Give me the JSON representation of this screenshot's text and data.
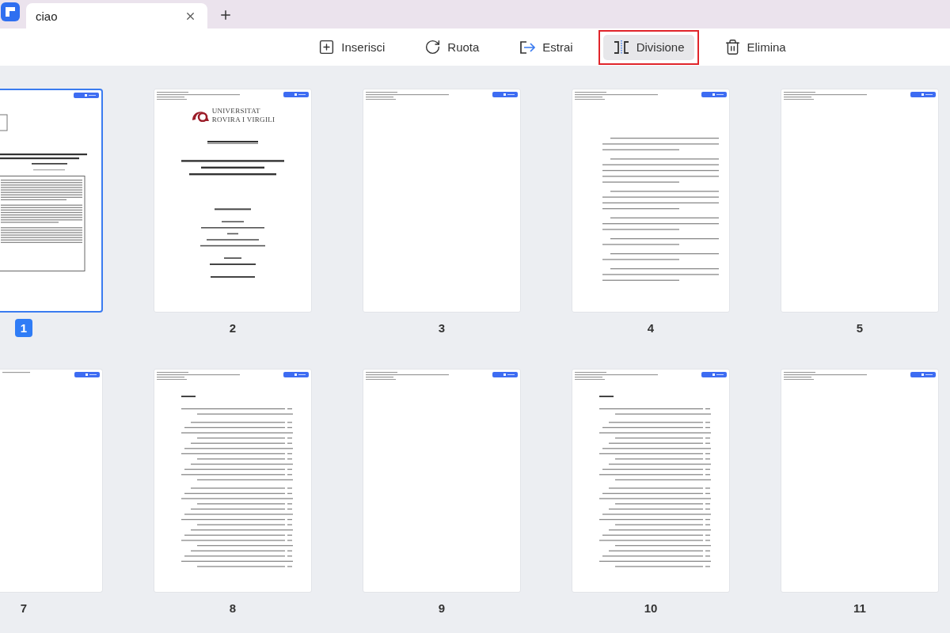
{
  "tabs": [
    {
      "title": "ciao",
      "selected": true
    }
  ],
  "toolbar": [
    {
      "label": "Inserisci",
      "kind": "insert",
      "selected": false,
      "outlined": false
    },
    {
      "label": "Ruota",
      "kind": "rotate",
      "selected": false,
      "outlined": false
    },
    {
      "label": "Estrai",
      "kind": "extract",
      "selected": false,
      "outlined": false
    },
    {
      "label": "Divisione",
      "kind": "split",
      "selected": true,
      "outlined": true
    },
    {
      "label": "Elimina",
      "kind": "delete",
      "selected": false,
      "outlined": false
    }
  ],
  "pages": [
    {
      "number": "1",
      "selected": true,
      "kind": "cover"
    },
    {
      "number": "2",
      "selected": false,
      "kind": "title",
      "logo_lines": [
        "UNIVERSITAT",
        "ROVIRA I VIRGILI"
      ]
    },
    {
      "number": "3",
      "selected": false,
      "kind": "blank"
    },
    {
      "number": "4",
      "selected": false,
      "kind": "letter"
    },
    {
      "number": "5",
      "selected": false,
      "kind": "blank"
    },
    {
      "number": "7",
      "selected": false,
      "kind": "blank"
    },
    {
      "number": "8",
      "selected": false,
      "kind": "index"
    },
    {
      "number": "9",
      "selected": false,
      "kind": "blank"
    },
    {
      "number": "10",
      "selected": false,
      "kind": "index"
    },
    {
      "number": "11",
      "selected": false,
      "kind": "blank"
    }
  ]
}
